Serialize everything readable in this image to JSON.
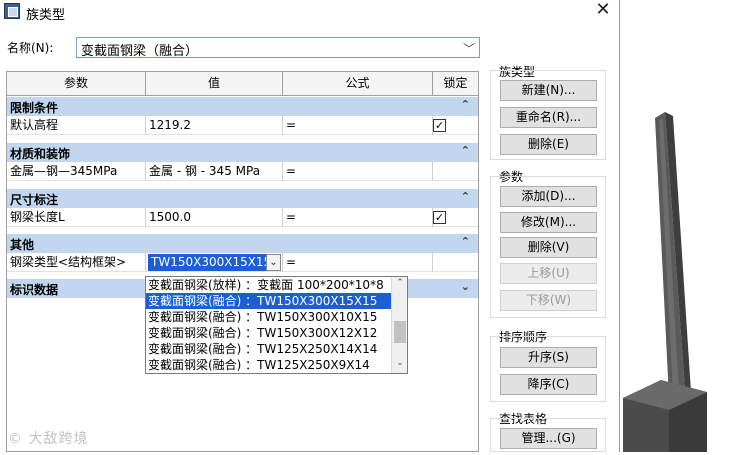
{
  "dialog": {
    "title": "族类型",
    "close_glyph": "✕",
    "name_label": "名称(N):",
    "name_value": "变截面钢梁（融合）",
    "dropdown_arrow_glyph": "﹀"
  },
  "table": {
    "headers": [
      "参数",
      "值",
      "公式",
      "锁定"
    ],
    "groups": [
      {
        "label": "限制条件",
        "chevron": "⌃"
      },
      {
        "label": "材质和装饰",
        "chevron": "⌃"
      },
      {
        "label": "尺寸标注",
        "chevron": "⌃"
      },
      {
        "label": "其他",
        "chevron": "⌃"
      },
      {
        "label": "标识数据",
        "chevron": "⌄"
      }
    ],
    "rows": [
      {
        "param": "默认高程",
        "value": "1219.2",
        "formula": "=",
        "locked": true
      },
      {
        "param": "金属—钢—345MPa",
        "value": "金属 - 钢 - 345 MPa",
        "formula": "=",
        "locked": false
      },
      {
        "param": "钢梁长度L",
        "value": "1500.0",
        "formula": "=",
        "locked": true
      },
      {
        "param": "钢梁类型<结构框架>",
        "value": "TW150X300X15X15",
        "formula": "=",
        "locked": false
      }
    ],
    "check_glyph": "✓",
    "combo_arrow_glyph": "⌄"
  },
  "type_dropdown": {
    "options": [
      "变截面钢梁(放样) ：变截面 100*200*10*8",
      "变截面钢梁(融合) ：TW150X300X15X15",
      "变截面钢梁(融合) ：TW150X300X10X15",
      "变截面钢梁(融合) ：TW150X300X12X12",
      "变截面钢梁(融合) ：TW125X250X14X14",
      "变截面钢梁(融合) ：TW125X250X9X14"
    ],
    "selected_index": 1,
    "scroll_up_glyph": "⌃",
    "scroll_down_glyph": "⌄"
  },
  "side_panel": {
    "family_types_label": "族类型",
    "new_btn": "新建(N)...",
    "rename_btn": "重命名(R)...",
    "delete_type_btn": "删除(E)",
    "params_label": "参数",
    "add_btn": "添加(D)...",
    "modify_btn": "修改(M)...",
    "delete_param_btn": "删除(V)",
    "move_up_btn": "上移(U)",
    "move_down_btn": "下移(W)",
    "sort_label": "排序顺序",
    "asc_btn": "升序(S)",
    "desc_btn": "降序(C)",
    "lookup_label": "查找表格",
    "manage_btn": "管理...(G)"
  },
  "watermark": "© 大敌跨境",
  "colors": {
    "group_header": "#c2d7ef",
    "selection": "#1c5fd4",
    "viewport_bg": "#ffffff",
    "model_dark": "#4f4f4f"
  }
}
